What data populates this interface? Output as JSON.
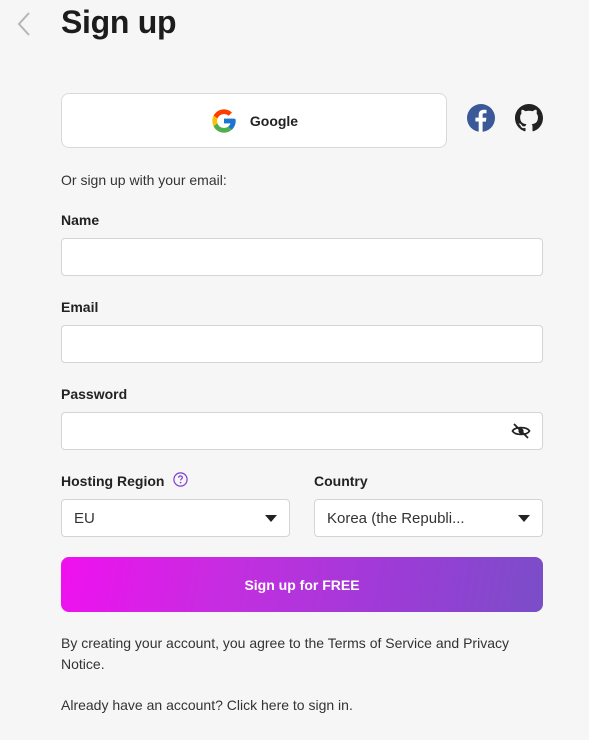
{
  "header": {
    "back_icon": "chevron-left-icon",
    "title": "Sign up"
  },
  "social": {
    "google_label": "Google",
    "google_icon": "google-icon",
    "facebook_icon": "facebook-icon",
    "github_icon": "github-icon",
    "facebook_color": "#3b5998",
    "github_color": "#222222"
  },
  "form": {
    "or_text": "Or sign up with your email:",
    "name_label": "Name",
    "name_value": "",
    "email_label": "Email",
    "email_value": "",
    "password_label": "Password",
    "password_value": "",
    "password_toggle_icon": "eye-slash-icon",
    "region_label": "Hosting Region",
    "region_help_icon": "help-circle-icon",
    "region_value": "EU",
    "country_label": "Country",
    "country_value": "Korea (the Republi...",
    "submit_label": "Sign up for FREE"
  },
  "footer": {
    "terms_prefix": "By creating your account, you agree to the ",
    "terms_link": "Terms of Service",
    "terms_middle": " and ",
    "privacy_link": "Privacy Notice",
    "terms_suffix": ".",
    "signin_prefix": "Already have an account? ",
    "signin_link": "Click here",
    "signin_suffix": " to sign in."
  },
  "colors": {
    "accent_start": "#f010ef",
    "accent_end": "#7a4ec8",
    "help_icon": "#7b3fd0",
    "background": "#f6f6f6"
  }
}
